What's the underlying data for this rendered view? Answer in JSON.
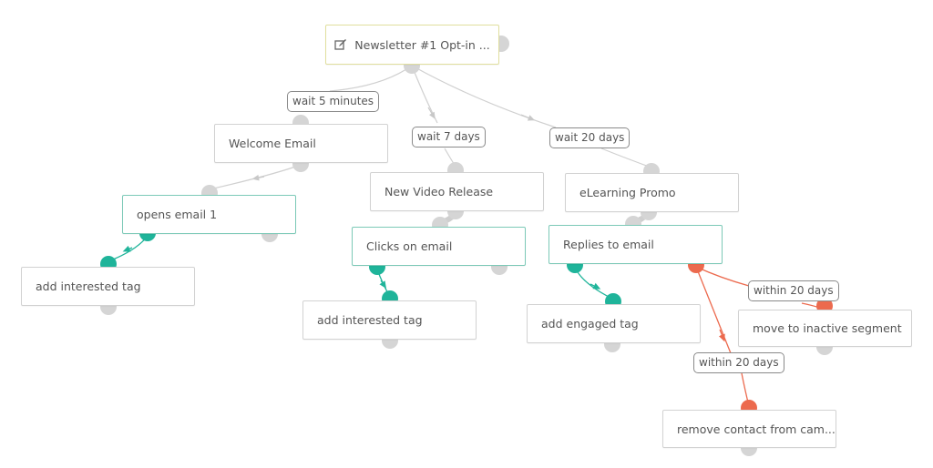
{
  "workflow": {
    "start_node": {
      "label": "Newsletter #1 Opt-in ...",
      "icon": "edit-icon"
    },
    "nodes": {
      "welcome_email": "Welcome Email",
      "opens_email_1": "opens email 1",
      "add_interested_tag_1": "add interested tag",
      "new_video_release": "New Video Release",
      "clicks_on_email": "Clicks on email",
      "add_interested_tag_2": "add interested tag",
      "elearning_promo": "eLearning Promo",
      "replies_to_email": "Replies to email",
      "add_engaged_tag": "add engaged tag",
      "move_to_inactive_segment": "move to inactive segment",
      "remove_contact": "remove contact from cam..."
    },
    "delays": {
      "wait_5_minutes": "wait 5 minutes",
      "wait_7_days": "wait 7 days",
      "wait_20_days": "wait 20 days",
      "within_20_days_a": "within 20 days",
      "within_20_days_b": "within 20 days"
    },
    "colors": {
      "yes_branch": "#1fb49a",
      "no_branch": "#ec6a4e",
      "neutral_edge": "#cfcfcf",
      "trigger_border": "#7cc9b7",
      "start_border": "#e0df9e"
    }
  }
}
